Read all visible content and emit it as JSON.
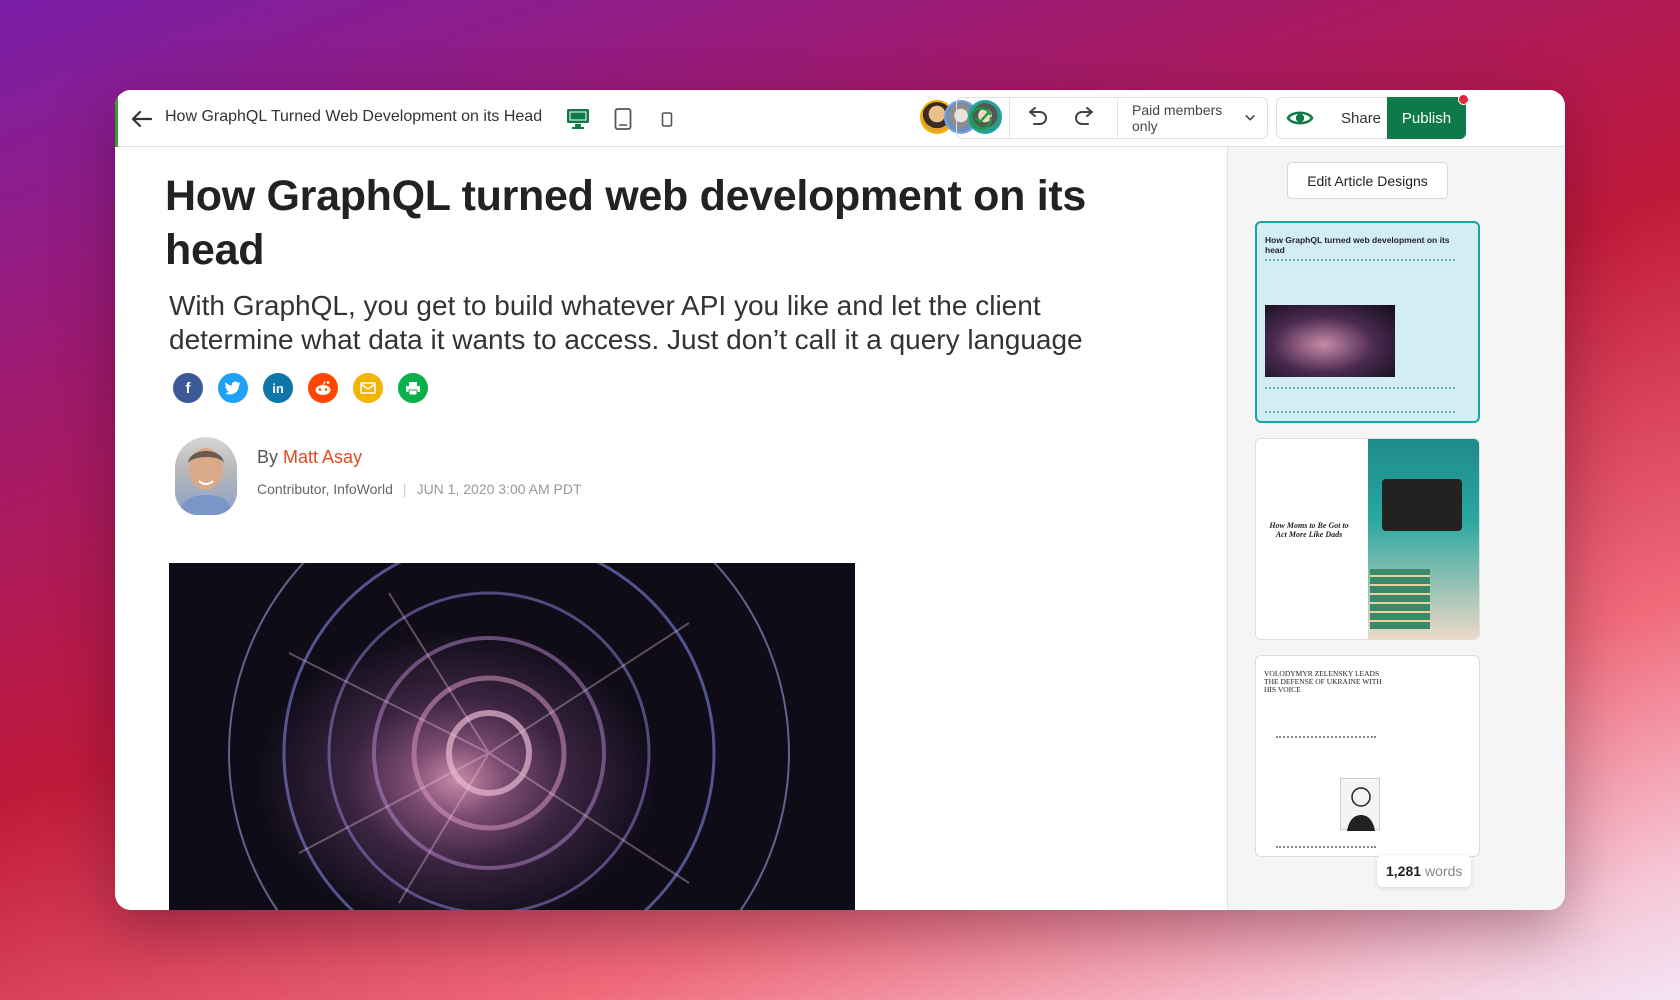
{
  "toolbar": {
    "title": "How GraphQL Turned Web Development on its Head",
    "back_icon": "arrow-left-icon",
    "devices": [
      "desktop-icon",
      "tablet-icon",
      "mobile-icon"
    ],
    "access": "Paid members only",
    "share_label": "Share",
    "publish_label": "Publish",
    "publish_color": "#0e7a4a"
  },
  "article": {
    "headline": "How GraphQL turned web development on its head",
    "dek": "With GraphQL, you get to build whatever API you like and let the client determine what data it wants to access. Just don’t call it a query language",
    "social": [
      "facebook-icon",
      "twitter-icon",
      "linkedin-icon",
      "reddit-icon",
      "email-icon",
      "print-icon"
    ],
    "by_label": "By",
    "author": "Matt Asay",
    "author_role": "Contributor, InfoWorld",
    "date": "JUN 1, 2020 3:00 AM PDT"
  },
  "panel": {
    "edit_label": "Edit Article Designs",
    "cards": [
      {
        "title": "How GraphQL turned web development on its head"
      },
      {
        "title": "How Moms to Be Got to Act More Like Dads"
      },
      {
        "title": "VOLODYMYR ZELENSKY LEADS THE DEFENSE OF UKRAINE WITH HIS VOICE"
      }
    ],
    "word_count": "1,281",
    "word_label": "words"
  }
}
